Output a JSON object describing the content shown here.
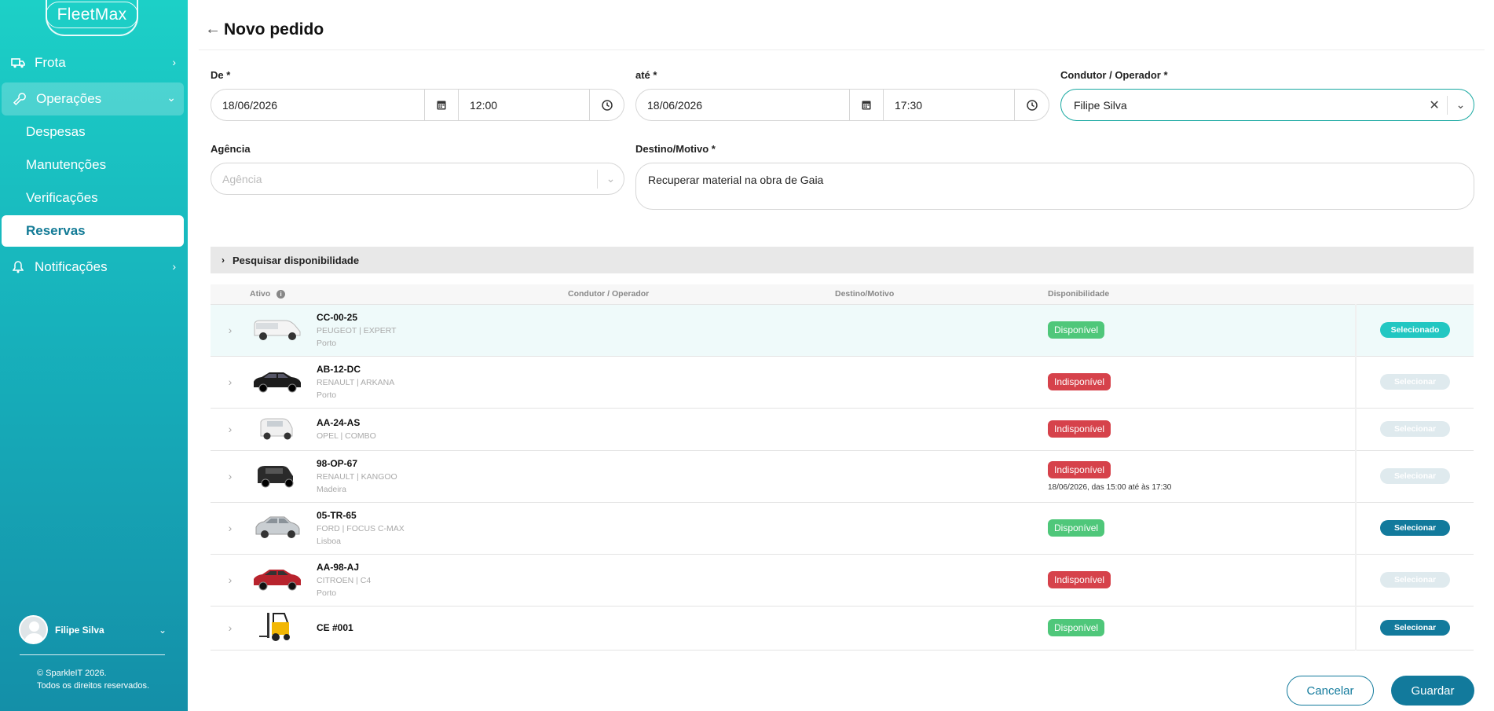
{
  "sidebar": {
    "logo": "FleetMax",
    "nav": [
      {
        "label": "Frota"
      },
      {
        "label": "Operações"
      },
      {
        "label": "Notificações"
      }
    ],
    "sub": [
      "Despesas",
      "Manutenções",
      "Verificações",
      "Reservas"
    ],
    "user": "Filipe Silva",
    "copyright_line1": "© SparkleIT 2026.",
    "copyright_line2": "Todos os direitos reservados."
  },
  "header": {
    "title": "Novo pedido"
  },
  "form": {
    "from_label": "De *",
    "from_date": "18/06/2026",
    "from_time": "12:00",
    "to_label": "até *",
    "to_date": "18/06/2026",
    "to_time": "17:30",
    "driver_label": "Condutor / Operador *",
    "driver_value": "Filipe Silva",
    "agency_label": "Agência",
    "agency_placeholder": "Agência",
    "dest_label": "Destino/Motivo *",
    "dest_value": "Recuperar material na obra de Gaia"
  },
  "search_availability": "Pesquisar disponibilidade",
  "table": {
    "headers": [
      "Ativo",
      "Condutor / Operador",
      "Destino/Motivo",
      "Disponibilidade"
    ],
    "rows": [
      {
        "plate": "CC-00-25",
        "model": "PEUGEOT | EXPERT",
        "location": "Porto",
        "status": "Disponível",
        "note": "",
        "action": "Selecionado"
      },
      {
        "plate": "AB-12-DC",
        "model": "RENAULT | ARKANA",
        "location": "Porto",
        "status": "Indisponível",
        "note": "",
        "action": "Selecionar"
      },
      {
        "plate": "AA-24-AS",
        "model": "OPEL | COMBO",
        "location": "",
        "status": "Indisponível",
        "note": "",
        "action": "Selecionar"
      },
      {
        "plate": "98-OP-67",
        "model": "RENAULT | KANGOO",
        "location": "Madeira",
        "status": "Indisponível",
        "note": "18/06/2026, das 15:00 até às 17:30",
        "action": "Selecionar"
      },
      {
        "plate": "05-TR-65",
        "model": "FORD | FOCUS C-MAX",
        "location": "Lisboa",
        "status": "Disponível",
        "note": "",
        "action": "Selecionar"
      },
      {
        "plate": "AA-98-AJ",
        "model": "CITROEN | C4",
        "location": "Porto",
        "status": "Indisponível",
        "note": "",
        "action": "Selecionar"
      },
      {
        "plate": "CE #001",
        "model": "",
        "location": "",
        "status": "Disponível",
        "note": "",
        "action": "Selecionar"
      }
    ]
  },
  "buttons": {
    "cancel": "Cancelar",
    "save": "Guardar"
  },
  "colors": {
    "primary": "#127a9c",
    "teal": "#1cd0c7",
    "available": "#4fc77a",
    "unavailable": "#d6424b"
  }
}
